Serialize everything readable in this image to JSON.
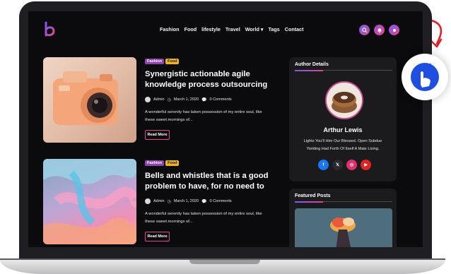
{
  "nav": {
    "items": [
      "Fashion",
      "Food",
      "lifestyle",
      "Travel",
      "World ▾",
      "Tags",
      "Contact"
    ]
  },
  "header_icons": [
    "search-icon",
    "bell-icon",
    "theme-toggle-icon"
  ],
  "posts": [
    {
      "tags": [
        "Fashion",
        "Food"
      ],
      "title": "Synergistic actionable agile knowledge process outsourcing",
      "author": "Admin",
      "date": "March 1, 2020",
      "comments": "0 Comments",
      "excerpt": "A wonderful serenity has taken possession of my entire soul, like these sweet mornings of...",
      "read_more": "Read More"
    },
    {
      "tags": [
        "Fashion",
        "Food"
      ],
      "title": "Bells and whistles that is a good problem to have, for no need to",
      "author": "Admin",
      "date": "March 1, 2020",
      "comments": "0 Comments",
      "excerpt": "A wonderful serenity has taken possession of my entire soul, like these sweet mornings of...",
      "read_more": "Read More"
    }
  ],
  "author_card": {
    "title": "Author Details",
    "name": "Arthur Lewis",
    "bio": "Lights You'll Him Our Blessed. Open Subdue Yielding Had Forth Of Itself A Male Living.",
    "socials": [
      {
        "name": "facebook-icon",
        "glyph": "f",
        "color": "#1877f2"
      },
      {
        "name": "x-icon",
        "glyph": "𝕏",
        "color": "#2a2a2e"
      },
      {
        "name": "instagram-icon",
        "glyph": "◎",
        "color": "#e1306c"
      },
      {
        "name": "youtube-icon",
        "glyph": "▶",
        "color": "#e02424"
      }
    ]
  },
  "featured": {
    "title": "Featured Posts"
  },
  "colors": {
    "accent_purple": "#7a5af5",
    "accent_pink": "#e0458f",
    "tag_fashion": "#8e44ad",
    "tag_food": "#f0b323",
    "fab_blue": "#1f4fe0"
  }
}
